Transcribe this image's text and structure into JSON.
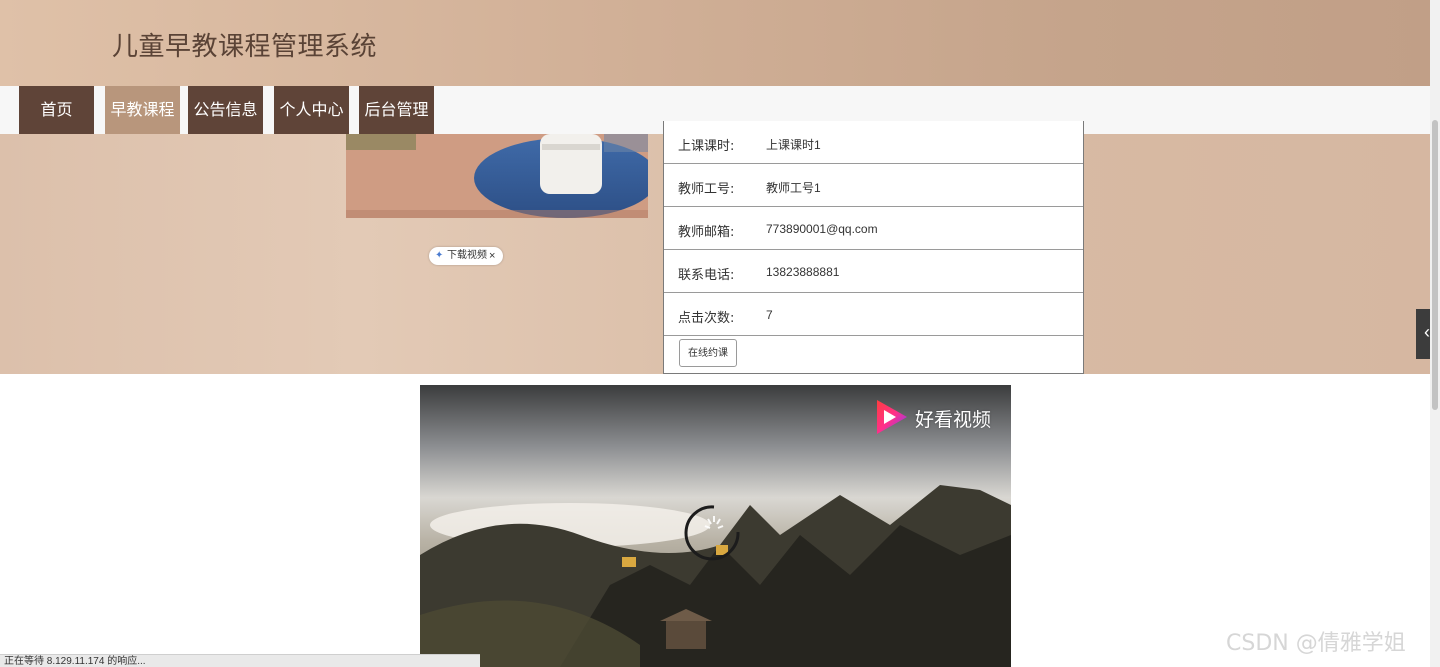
{
  "header": {
    "title": "儿童早教课程管理系统"
  },
  "nav": {
    "items": [
      {
        "label": "首页",
        "active": false
      },
      {
        "label": "早教课程",
        "active": true
      },
      {
        "label": "公告信息",
        "active": false
      },
      {
        "label": "个人中心",
        "active": false
      },
      {
        "label": "后台管理",
        "active": false
      }
    ]
  },
  "detail": {
    "download_badge": "下载视频",
    "download_close": "×",
    "rows": [
      {
        "label": "上课课时:",
        "value": "上课课时1"
      },
      {
        "label": "教师工号:",
        "value": "教师工号1"
      },
      {
        "label": "教师邮箱:",
        "value": "773890001@qq.com"
      },
      {
        "label": "联系电话:",
        "value": "13823888881"
      },
      {
        "label": "点击次数:",
        "value": "7"
      }
    ],
    "book_button": "在线约课"
  },
  "side_toggle": {
    "icon": "chevron-left-icon",
    "glyph": "‹"
  },
  "video": {
    "brand": "好看视频",
    "state": "loading"
  },
  "browser": {
    "status": "正在等待 8.129.11.174 的响应..."
  },
  "watermark": "CSDN @倩雅学姐",
  "colors": {
    "nav_bg": "#5f4438",
    "nav_active": "#b8967c",
    "header_bg": "#d2b198",
    "title_text": "#5a4336"
  }
}
